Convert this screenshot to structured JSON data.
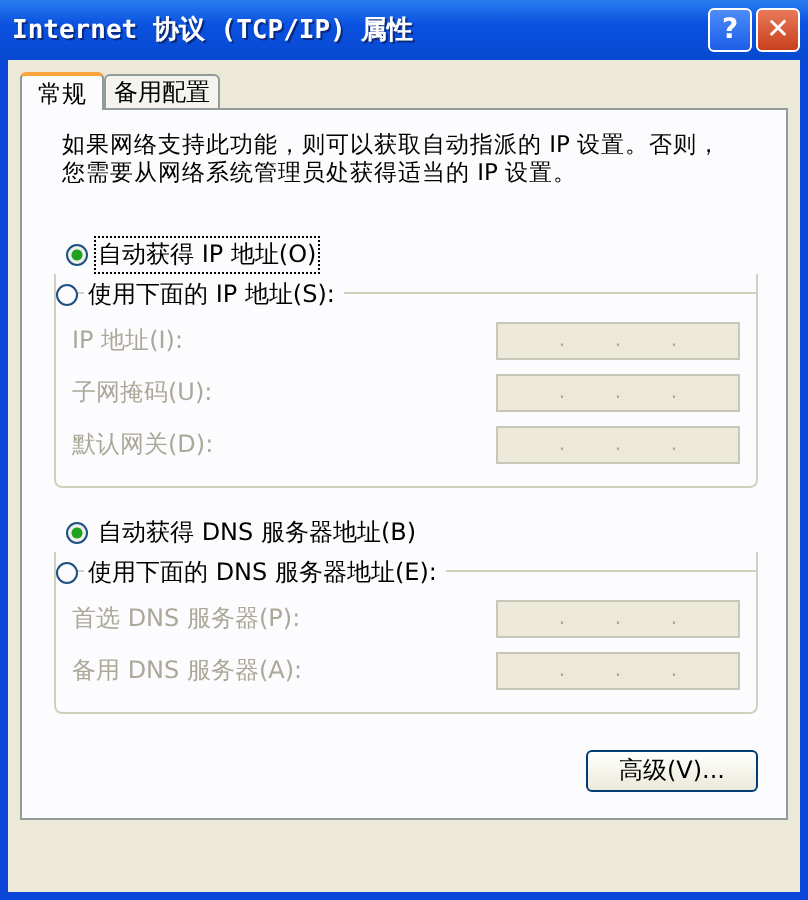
{
  "window": {
    "title": "Internet 协议 (TCP/IP) 属性",
    "help_button": "?",
    "close_button": "✕"
  },
  "tabs": [
    {
      "label": "常规",
      "selected": true
    },
    {
      "label": "备用配置",
      "selected": false
    }
  ],
  "description": "如果网络支持此功能，则可以获取自动指派的 IP 设置。否则，您需要从网络系统管理员处获得适当的 IP 设置。",
  "ip_section": {
    "options": [
      {
        "label": "自动获得 IP 地址(O)",
        "selected": true,
        "focused": true
      },
      {
        "label": "使用下面的 IP 地址(S):",
        "selected": false,
        "focused": false
      }
    ],
    "fields": [
      {
        "label": "IP 地址(I):",
        "disabled": true,
        "separators": [
          ".",
          ".",
          "."
        ]
      },
      {
        "label": "子网掩码(U):",
        "disabled": true,
        "separators": [
          ".",
          ".",
          "."
        ]
      },
      {
        "label": "默认网关(D):",
        "disabled": true,
        "separators": [
          ".",
          ".",
          "."
        ]
      }
    ]
  },
  "dns_section": {
    "options": [
      {
        "label": "自动获得 DNS 服务器地址(B)",
        "selected": true,
        "focused": false
      },
      {
        "label": "使用下面的 DNS 服务器地址(E):",
        "selected": false,
        "focused": false
      }
    ],
    "fields": [
      {
        "label": "首选 DNS 服务器(P):",
        "disabled": true,
        "separators": [
          ".",
          ".",
          "."
        ]
      },
      {
        "label": "备用 DNS 服务器(A):",
        "disabled": true,
        "separators": [
          ".",
          ".",
          "."
        ]
      }
    ]
  },
  "advanced_button": "高级(V)..."
}
